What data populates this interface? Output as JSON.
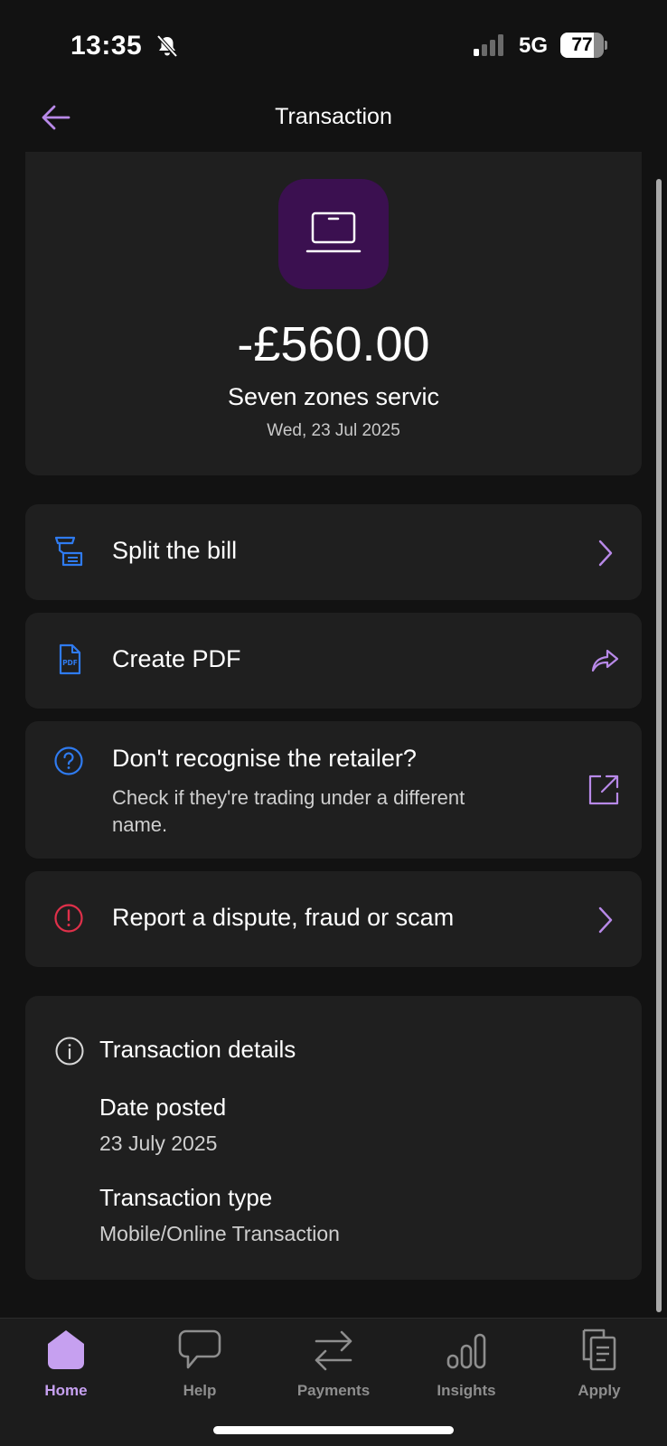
{
  "status_bar": {
    "time": "13:35",
    "network": "5G",
    "battery": "77",
    "battery_level": 0.77,
    "icons": [
      "bell-slash-icon",
      "cellular-signal-icon"
    ]
  },
  "header": {
    "title": "Transaction",
    "back_icon": "arrow-left-icon"
  },
  "transaction": {
    "amount": "-£560.00",
    "merchant": "Seven zones servic",
    "date": "Wed, 23 Jul 2025",
    "merchant_icon": "laptop-icon"
  },
  "actions": [
    {
      "label": "Split the bill",
      "icon": "receipt-split-icon",
      "trailing_icon": "chevron-right-icon"
    },
    {
      "label": "Create PDF",
      "icon": "pdf-file-icon",
      "trailing_icon": "share-arrow-icon"
    },
    {
      "label": "Don't recognise the retailer?",
      "subtitle": "Check if they're trading under a different name.",
      "icon": "question-circle-icon",
      "trailing_icon": "external-link-icon"
    },
    {
      "label": "Report a dispute, fraud or scam",
      "icon": "alert-circle-icon",
      "trailing_icon": "chevron-right-icon"
    }
  ],
  "details": {
    "title": "Transaction details",
    "date_posted_label": "Date posted",
    "date_posted_value": "23 July 2025",
    "type_label": "Transaction type",
    "type_value": "Mobile/Online Transaction"
  },
  "tabbar": [
    {
      "label": "Home",
      "icon": "home-icon",
      "active": true
    },
    {
      "label": "Help",
      "icon": "chat-bubble-icon",
      "active": false
    },
    {
      "label": "Payments",
      "icon": "transfer-arrows-icon",
      "active": false
    },
    {
      "label": "Insights",
      "icon": "bar-chart-icon",
      "active": false
    },
    {
      "label": "Apply",
      "icon": "documents-icon",
      "active": false
    }
  ],
  "colors": {
    "background": "#121212",
    "card": "#1f1f1f",
    "accent_purple": "#b889e8",
    "icon_blue": "#2f7bf0",
    "alert_red": "#e0304a",
    "merchant_tile": "#3b1050"
  }
}
